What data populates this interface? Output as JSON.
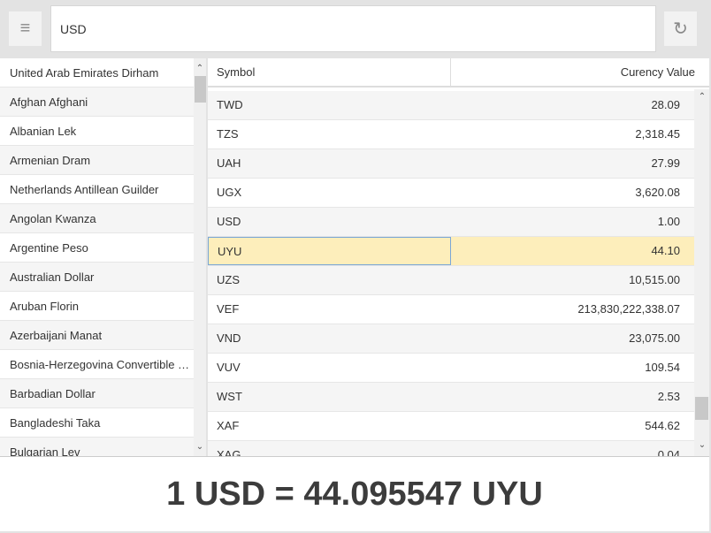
{
  "toolbar": {
    "menu_icon": "hamburger-icon",
    "refresh_icon": "refresh-icon",
    "input_value": "USD"
  },
  "currency_list": [
    "United Arab Emirates Dirham",
    "Afghan Afghani",
    "Albanian Lek",
    "Armenian Dram",
    "Netherlands Antillean Guilder",
    "Angolan Kwanza",
    "Argentine Peso",
    "Australian Dollar",
    "Aruban Florin",
    "Azerbaijani Manat",
    "Bosnia-Herzegovina Convertible Mark",
    "Barbadian Dollar",
    "Bangladeshi Taka",
    "Bulgarian Lev"
  ],
  "table": {
    "headers": {
      "symbol": "Symbol",
      "value": "Curency Value"
    },
    "rows": [
      [
        "TWD",
        "28.09"
      ],
      [
        "TZS",
        "2,318.45"
      ],
      [
        "UAH",
        "27.99"
      ],
      [
        "UGX",
        "3,620.08"
      ],
      [
        "USD",
        "1.00"
      ],
      [
        "UYU",
        "44.10"
      ],
      [
        "UZS",
        "10,515.00"
      ],
      [
        "VEF",
        "213,830,222,338.07"
      ],
      [
        "VND",
        "23,075.00"
      ],
      [
        "VUV",
        "109.54"
      ],
      [
        "WST",
        "2.53"
      ],
      [
        "XAF",
        "544.62"
      ],
      [
        "XAG",
        "0.04"
      ]
    ],
    "selected_symbol": "UYU",
    "selected_color": "#fdeebb"
  },
  "result": "1 USD = 44.095547 UYU"
}
